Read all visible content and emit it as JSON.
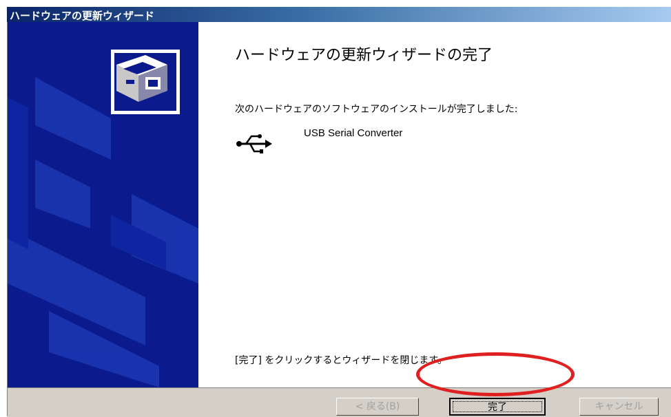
{
  "window": {
    "title": "ハードウェアの更新ウィザード"
  },
  "main": {
    "heading": "ハードウェアの更新ウィザードの完了",
    "intro": "次のハードウェアのソフトウェアのインストールが完了しました:",
    "device": {
      "icon": "usb-icon",
      "name": "USB Serial Converter"
    },
    "footer_hint": "[完了] をクリックするとウィザードを閉じます。"
  },
  "buttons": {
    "back_label": "< 戻る(B)",
    "finish_label": "完了",
    "cancel_label": "キャンセル"
  },
  "annotation": {
    "highlight_color": "#e02020",
    "highlight_target": "finish-button"
  },
  "colors": {
    "banner": "#0b1a8c",
    "titlebar_start": "#0a246a",
    "button_face": "#d4d0c8"
  }
}
